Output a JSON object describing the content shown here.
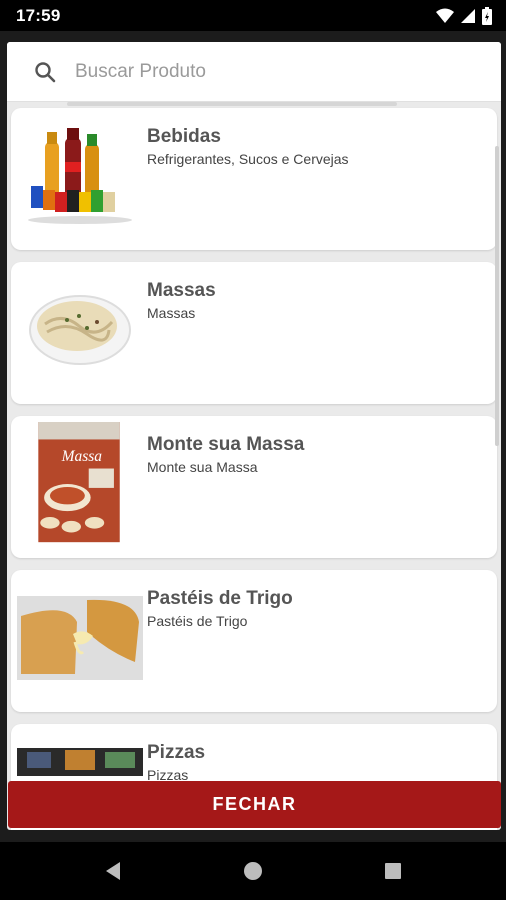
{
  "status_bar": {
    "time": "17:59"
  },
  "search": {
    "placeholder": "Buscar Produto"
  },
  "categories": [
    {
      "title": "Bebidas",
      "subtitle": "Refrigerantes, Sucos e Cervejas"
    },
    {
      "title": "Massas",
      "subtitle": "Massas"
    },
    {
      "title": "Monte sua Massa",
      "subtitle": "Monte sua Massa",
      "poster_text": "Massa"
    },
    {
      "title": "Pastéis de Trigo",
      "subtitle": "Pastéis de Trigo"
    },
    {
      "title": "Pizzas",
      "subtitle": "Pizzas"
    }
  ],
  "footer": {
    "close_label": "FECHAR"
  },
  "colors": {
    "accent": "#a51818",
    "card_bg": "#ffffff",
    "list_bg": "#eaeaea"
  }
}
